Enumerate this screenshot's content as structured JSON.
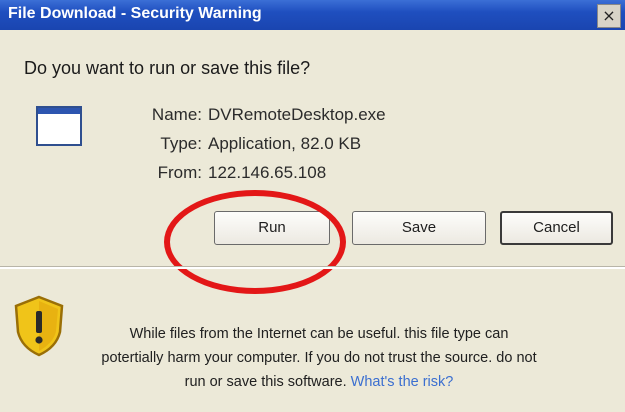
{
  "window": {
    "title": "File Download - Security Warning",
    "close_label": "×"
  },
  "dialog": {
    "question": "Do you want to run or save this file?",
    "file_icon": "application-window-icon",
    "info": {
      "name_label": "Name:",
      "name_value": "DVRemoteDesktop.exe",
      "type_label": "Type:",
      "type_value": "Application, 82.0 KB",
      "from_label": "From:",
      "from_value": "122.146.65.108"
    },
    "buttons": {
      "run": "Run",
      "save": "Save",
      "cancel": "Cancel"
    },
    "warning": {
      "icon": "shield-warning-icon",
      "line1": "While files from the Internet can be useful. this file type can",
      "line2": "potertially harm your computer. If you do not trust the source. do not",
      "line3": "run or save this software.",
      "link": "What's the risk?"
    }
  },
  "annotation": {
    "highlight_color": "#e31717"
  },
  "colors": {
    "titlebar": "#1f4fbf",
    "dialog_bg": "#ece9d8",
    "link": "#3b6fd0"
  }
}
